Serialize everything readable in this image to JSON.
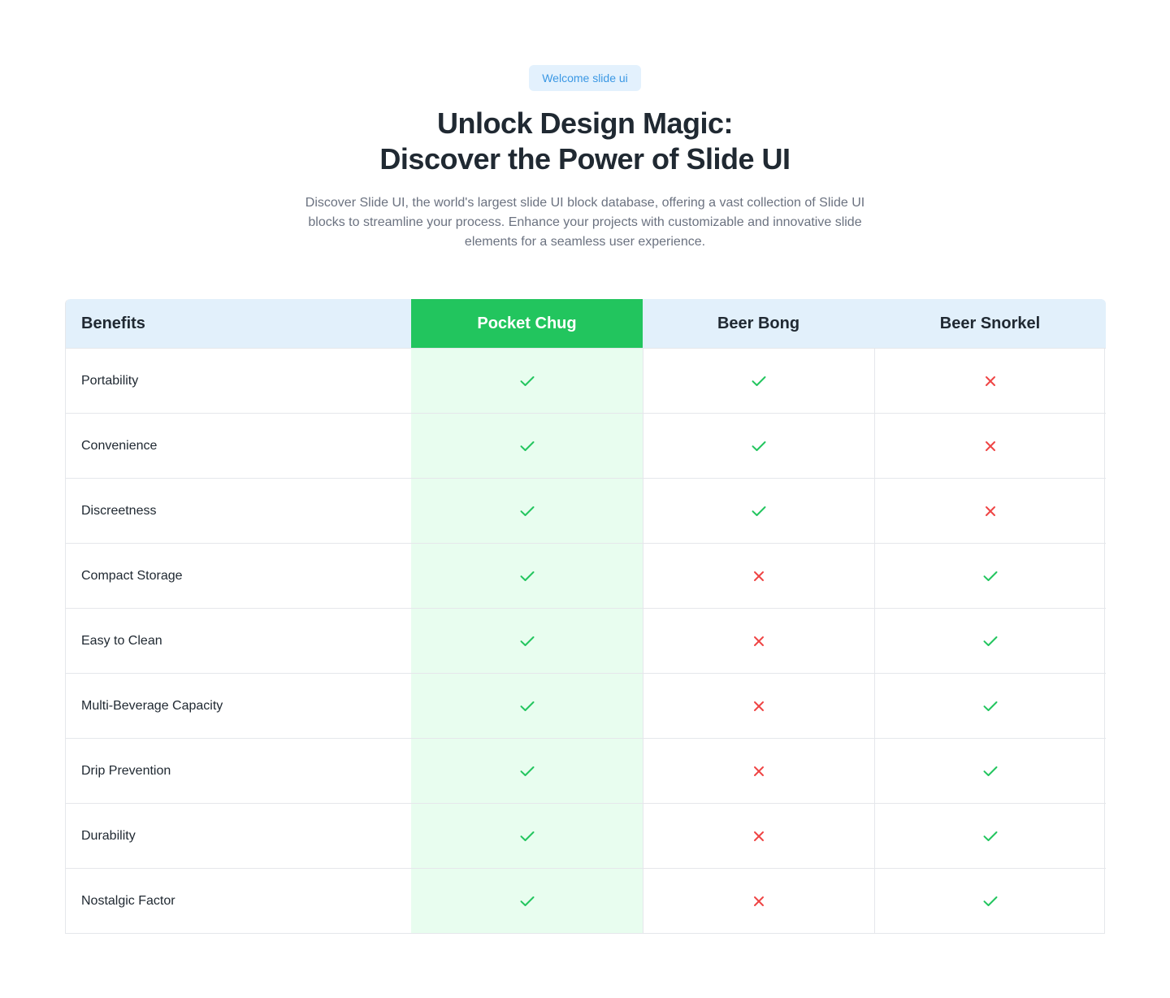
{
  "hero": {
    "badge": "Welcome slide ui",
    "title_line1": "Unlock Design Magic:",
    "title_line2": "Discover the Power of Slide UI",
    "description": "Discover Slide UI, the world's largest slide UI block database, offering a vast collection of Slide UI blocks to streamline your process. Enhance your projects with customizable and innovative slide elements for a seamless user experience."
  },
  "colors": {
    "featured": "#22c55e",
    "featured_bg": "#e8fdef",
    "header_bg": "#e2f0fb",
    "check": "#22c55e",
    "cross": "#ef4444"
  },
  "comparison": {
    "columns": [
      "Benefits",
      "Pocket Chug",
      "Beer Bong",
      "Beer Snorkel"
    ],
    "featured_column": 1,
    "rows": [
      {
        "label": "Portability",
        "values": [
          true,
          true,
          false
        ]
      },
      {
        "label": "Convenience",
        "values": [
          true,
          true,
          false
        ]
      },
      {
        "label": "Discreetness",
        "values": [
          true,
          true,
          false
        ]
      },
      {
        "label": "Compact Storage",
        "values": [
          true,
          false,
          true
        ]
      },
      {
        "label": "Easy to Clean",
        "values": [
          true,
          false,
          true
        ]
      },
      {
        "label": "Multi-Beverage Capacity",
        "values": [
          true,
          false,
          true
        ]
      },
      {
        "label": "Drip Prevention",
        "values": [
          true,
          false,
          true
        ]
      },
      {
        "label": "Durability",
        "values": [
          true,
          false,
          true
        ]
      },
      {
        "label": "Nostalgic Factor",
        "values": [
          true,
          false,
          true
        ]
      }
    ]
  }
}
